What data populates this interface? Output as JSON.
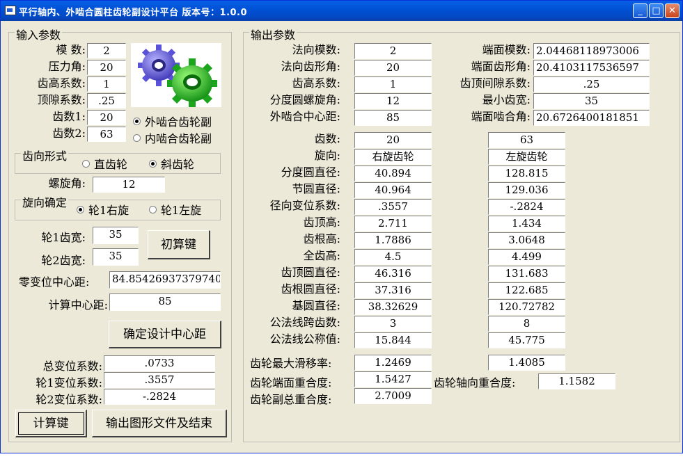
{
  "window": {
    "title": "平行轴内、外啮合圆柱齿轮副设计平台  版本号：1.0.0",
    "minimize_glyph": "_",
    "maximize_glyph": "□",
    "close_glyph": "✕"
  },
  "input": {
    "legend": "输入参数",
    "module_label": "模    数:",
    "module_value": "2",
    "pressure_angle_label": "压力角:",
    "pressure_angle_value": "20",
    "addendum_coef_label": "齿高系数:",
    "addendum_coef_value": "1",
    "clearance_coef_label": "顶隙系数:",
    "clearance_coef_value": ".25",
    "teeth1_label": "齿数1:",
    "teeth1_value": "20",
    "teeth2_label": "齿数2:",
    "teeth2_value": "63",
    "mesh_external": "外啮合齿轮副",
    "mesh_internal": "内啮合齿轮副",
    "tooth_form_legend": "齿向形式",
    "spur": "直齿轮",
    "helical": "斜齿轮",
    "helix_angle_label": "螺旋角:",
    "helix_angle_value": "12",
    "hand_legend": "旋向确定",
    "gear1_right": "轮1右旋",
    "gear1_left": "轮1左旋",
    "width1_label": "轮1齿宽:",
    "width1_value": "35",
    "width2_label": "轮2齿宽:",
    "width2_value": "35",
    "initial_calc_button": "初算键",
    "zero_shift_center_label": "零变位中心距:",
    "zero_shift_center_value": "84.85426937379740",
    "calc_center_label": "计算中心距:",
    "calc_center_value": "85",
    "confirm_center_button": "确定设计中心距",
    "total_shift_label": "总变位系数:",
    "total_shift_value": ".0733",
    "shift1_label": "轮1变位系数:",
    "shift1_value": ".3557",
    "shift2_label": "轮2变位系数:",
    "shift2_value": "-.2824",
    "calc_button": "计算键",
    "output_button": "输出图形文件及结束"
  },
  "output": {
    "legend": "输出参数",
    "normal_module_label": "法向模数:",
    "normal_module_value": "2",
    "normal_profile_label": "法向齿形角:",
    "normal_profile_value": "20",
    "addendum_coef_label": "齿高系数:",
    "addendum_coef_value": "1",
    "ref_helix_label": "分度圆螺旋角:",
    "ref_helix_value": "12",
    "ext_center_label": "外啮合中心距:",
    "ext_center_value": "85",
    "transverse_module_label": "端面模数:",
    "transverse_module_value": "2.04468118973006",
    "transverse_profile_label": "端面齿形角:",
    "transverse_profile_value": "20.4103117536597",
    "tip_clearance_label": "齿顶间隙系数:",
    "tip_clearance_value": ".25",
    "min_width_label": "最小齿宽:",
    "min_width_value": "35",
    "transverse_mesh_label": "端面啮合角:",
    "transverse_mesh_value": "20.6726400181851",
    "rows": [
      {
        "label": "齿数:",
        "g1": "20",
        "g2": "63"
      },
      {
        "label": "旋向:",
        "g1": "右旋齿轮",
        "g2": "左旋齿轮"
      },
      {
        "label": "分度圆直径:",
        "g1": "40.894",
        "g2": "128.815"
      },
      {
        "label": "节圆直径:",
        "g1": "40.964",
        "g2": "129.036"
      },
      {
        "label": "径向变位系数:",
        "g1": ".3557",
        "g2": "-.2824"
      },
      {
        "label": "齿顶高:",
        "g1": "2.711",
        "g2": "1.434"
      },
      {
        "label": "齿根高:",
        "g1": "1.7886",
        "g2": "3.0648"
      },
      {
        "label": "全齿高:",
        "g1": "4.5",
        "g2": "4.499"
      },
      {
        "label": "齿顶圆直径:",
        "g1": "46.316",
        "g2": "131.683"
      },
      {
        "label": "齿根圆直径:",
        "g1": "37.316",
        "g2": "122.685"
      },
      {
        "label": "基圆直径:",
        "g1": "38.32629",
        "g2": "120.72782"
      },
      {
        "label": "公法线跨齿数:",
        "g1": "3",
        "g2": "8"
      },
      {
        "label": "公法线公称值:",
        "g1": "15.844",
        "g2": "45.775"
      }
    ],
    "max_slide_label": "齿轮最大滑移率:",
    "max_slide_g1": "1.2469",
    "max_slide_g2": "1.4085",
    "transverse_contact_label": "齿轮端面重合度:",
    "transverse_contact_value": "1.5427",
    "axial_contact_label": "齿轮轴向重合度:",
    "axial_contact_value": "1.1582",
    "total_contact_label": "齿轮副总重合度:",
    "total_contact_value": "2.7009"
  }
}
